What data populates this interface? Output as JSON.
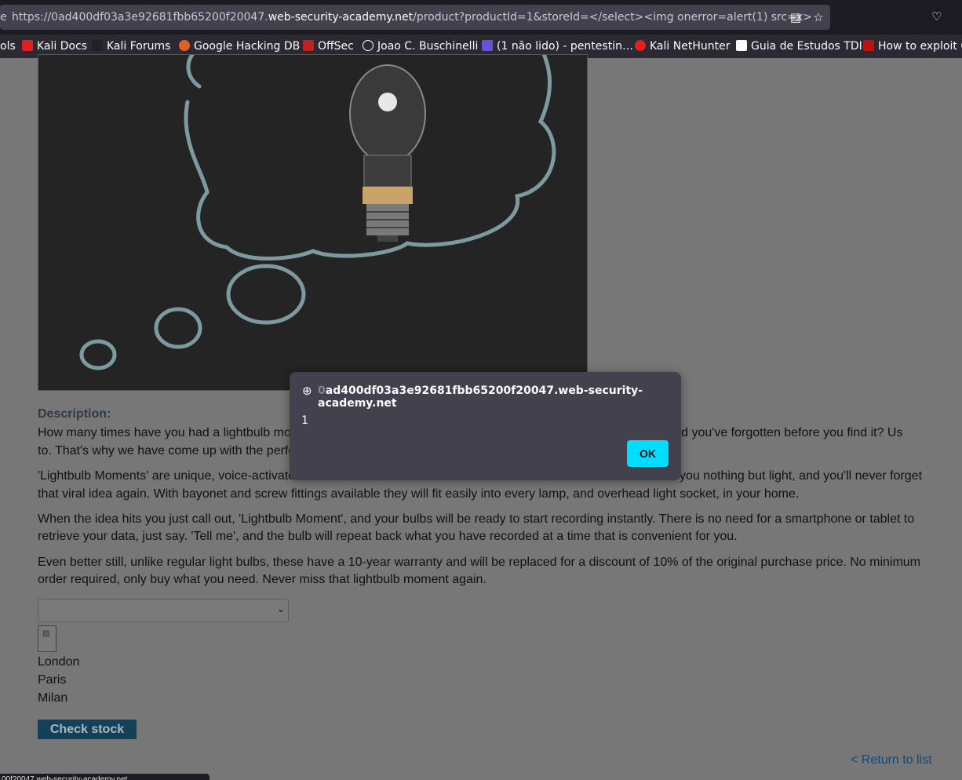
{
  "browser": {
    "url_prefix": "https://0ad400df03a3e92681fbb65200f20047.",
    "url_host": "web-security-academy.net",
    "url_path": "/product?productId=1&storeId=</select><img onerror=alert(1) src=x>",
    "edge_fragment": "e"
  },
  "bookmarks": [
    {
      "label": "ols",
      "color": ""
    },
    {
      "label": "Kali Docs",
      "color": "#e02020"
    },
    {
      "label": "Kali Forums",
      "color": "#222222"
    },
    {
      "label": "Google Hacking DB",
      "color": "#e0602a"
    },
    {
      "label": "OffSec",
      "color": "#c02020"
    },
    {
      "label": "Joao C. Buschinelli",
      "color": ""
    },
    {
      "label": "(1 não lido) - pentestin…",
      "color": "#6b4fd8"
    },
    {
      "label": "Kali NetHunter",
      "color": "#e02020"
    },
    {
      "label": "Guia de Estudos TDI",
      "color": "#222222"
    },
    {
      "label": "How to exploit C",
      "color": "#c01010"
    }
  ],
  "product": {
    "description_label": "Description:",
    "paragraphs": [
      "How many times have you had a lightbulb mo",
      "n and you've forgotten before you find it? Us",
      "to. That's why we have come up with the perfe",
      "'Lightbulb Moments' are unique, voice-activate",
      "you nothing but light, and you'll never forget",
      "that viral idea again. With bayonet and screw fittings available they will fit easily into every lamp, and overhead light socket, in your home.",
      "When the idea hits you just call out, 'Lightbulb Moment', and your bulbs will be ready to start recording instantly. There is no need for a smartphone or tablet to",
      "retrieve your data, just say. 'Tell me', and the bulb will repeat back what you have recorded at a time that is convenient for you.",
      "Even better still, unlike regular light bulbs, these have a 10-year warranty and will be replaced for a discount of 10% of the original purchase price. No minimum",
      "order required, only buy what you need. Never miss that lightbulb moment again."
    ],
    "stores": [
      "London",
      "Paris",
      "Milan"
    ],
    "check_stock_label": "Check stock",
    "return_label": "< Return to list"
  },
  "dialog": {
    "origin_faded": "0",
    "origin": "ad400df03a3e92681fbb65200f20047.web-security-academy.net",
    "message": "1",
    "ok_label": "OK"
  },
  "status_fragment": "00f20047.web-security-academy.net..."
}
